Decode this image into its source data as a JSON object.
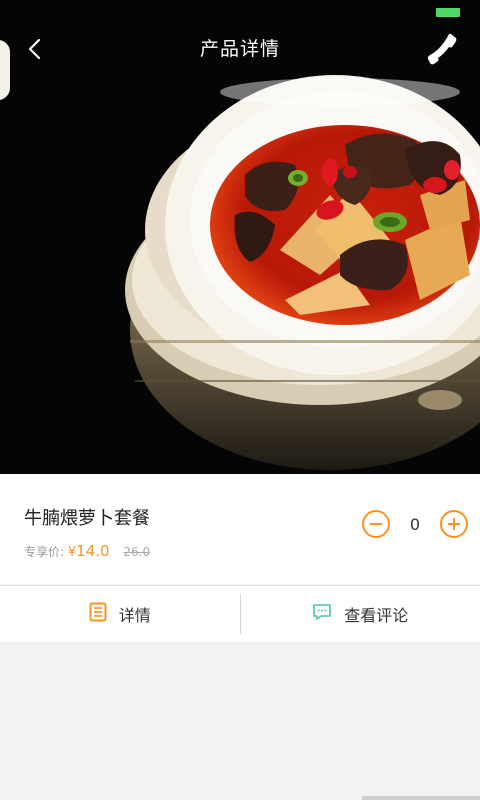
{
  "header": {
    "title": "产品详情",
    "back_icon": "chevron-left-icon",
    "phone_icon": "phone-icon"
  },
  "product": {
    "name": "牛腩煨萝卜套餐",
    "price_label": "专享价:",
    "currency": "¥",
    "price": "14.0",
    "original_price": "26.0",
    "quantity": "0"
  },
  "tabs": [
    {
      "label": "详情",
      "icon": "document-icon",
      "icon_color": "#f7931e"
    },
    {
      "label": "查看评论",
      "icon": "comment-icon",
      "icon_color": "#4cc3b0"
    }
  ],
  "colors": {
    "accent": "#f7931e",
    "comment_icon": "#4cc3b0",
    "battery": "#4cd964"
  }
}
